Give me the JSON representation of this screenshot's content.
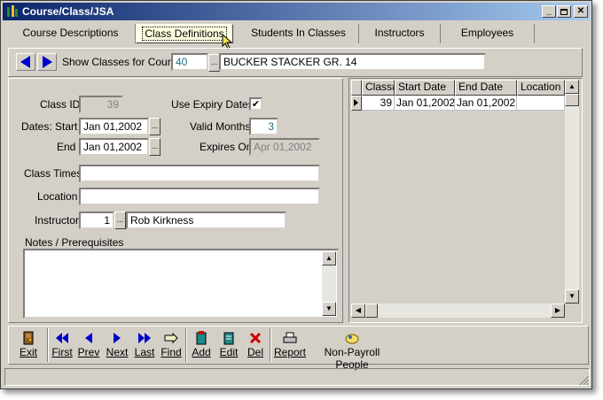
{
  "window": {
    "title": "Course/Class/JSA"
  },
  "tabs": [
    "Course Descriptions",
    "Class Definitions",
    "Students In Classes",
    "Instructors",
    "Employees"
  ],
  "course": {
    "label": "Show Classes for Course",
    "code": "40",
    "name": "BUCKER STACKER GR. 14"
  },
  "form": {
    "class_id_label": "Class ID",
    "class_id": "39",
    "use_expiry_label": "Use Expiry Dates",
    "use_expiry_check": "✔",
    "dates_start_label": "Dates: Start",
    "start_date": "Jan 01,2002",
    "valid_months_label": "Valid Months",
    "valid_months": "3",
    "end_label": "End",
    "end_date": "Jan 01,2002",
    "expires_label": "Expires On",
    "expires_on": "Apr 01,2002",
    "class_times_label": "Class Times",
    "class_times": "",
    "location_label": "Location",
    "location": "",
    "instructor_label": "Instructor",
    "instructor_id": "1",
    "instructor_name": "Rob Kirkness",
    "notes_label": "Notes / Prerequisites",
    "notes": ""
  },
  "dots": "...",
  "grid": {
    "columns": [
      "Class#",
      "Start Date",
      "End Date",
      "Location"
    ],
    "rows": [
      {
        "class_no": "39",
        "start": "Jan 01,2002",
        "end": "Jan 01,2002",
        "location": ""
      }
    ]
  },
  "toolbar": {
    "exit": "Exit",
    "first": "First",
    "prev": "Prev",
    "next": "Next",
    "last": "Last",
    "find": "Find",
    "add": "Add",
    "edit": "Edit",
    "del": "Del",
    "report": "Report",
    "non_payroll": "Non-Payroll People"
  },
  "colors": {
    "title_start": "#0a246a",
    "title_end": "#a6caf0",
    "active_tab": "#ffffe1",
    "nav_blue": "#0000cc",
    "del_red": "#cc0000"
  }
}
